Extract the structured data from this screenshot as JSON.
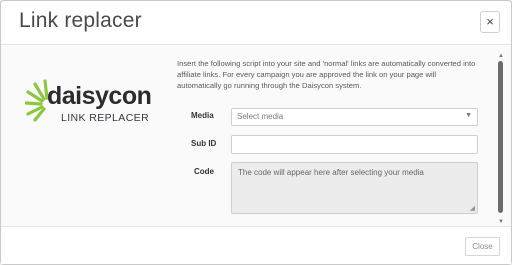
{
  "modal": {
    "title": "Link replacer",
    "close_icon": "×"
  },
  "logo": {
    "wordmark": "daisycon",
    "subtitle": "LINK REPLACER",
    "colors": {
      "rays": "#8dc63f",
      "text": "#2c2c2c"
    }
  },
  "intro": "Insert the following script into your site and 'normal' links are automatically converted into affiliate links. For every campaign you are approved the link on your page will automatically go running through the Daisycon system.",
  "form": {
    "media": {
      "label": "Media",
      "selected": "Select media",
      "caret": "▼"
    },
    "sub_id": {
      "label": "Sub ID",
      "value": "",
      "placeholder": ""
    },
    "code": {
      "label": "Code",
      "placeholder": "The code will appear here after selecting your media"
    }
  },
  "scrollbar": {
    "up": "▲",
    "down": "▼"
  },
  "footer": {
    "close_label": "Close"
  }
}
